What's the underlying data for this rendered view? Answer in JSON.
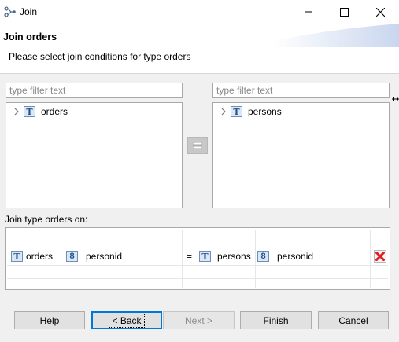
{
  "window": {
    "title": "Join"
  },
  "header": {
    "heading": "Join orders",
    "description": "Please select join conditions for type orders"
  },
  "left_panel": {
    "filter_placeholder": "type filter text",
    "items": [
      {
        "label": "orders",
        "icon": "table-type-icon"
      }
    ]
  },
  "right_panel": {
    "filter_placeholder": "type filter text",
    "items": [
      {
        "label": "persons",
        "icon": "table-type-icon"
      }
    ]
  },
  "join": {
    "label": "Join type orders on:",
    "rows": [
      {
        "left_type": "orders",
        "left_field": "personid",
        "operator": "=",
        "right_type": "persons",
        "right_field": "personid"
      }
    ]
  },
  "buttons": {
    "help": {
      "pre": "",
      "mnemonic": "H",
      "post": "elp"
    },
    "back": {
      "pre": "< ",
      "mnemonic": "B",
      "post": "ack"
    },
    "next": {
      "pre": "",
      "mnemonic": "N",
      "post": "ext >"
    },
    "finish": {
      "pre": "",
      "mnemonic": "F",
      "post": "inish"
    },
    "cancel": "Cancel"
  },
  "colors": {
    "delete_icon": "#e02020",
    "focus": "#0078d7"
  },
  "icons": {
    "table_letter": "T",
    "field_digit": "8"
  }
}
